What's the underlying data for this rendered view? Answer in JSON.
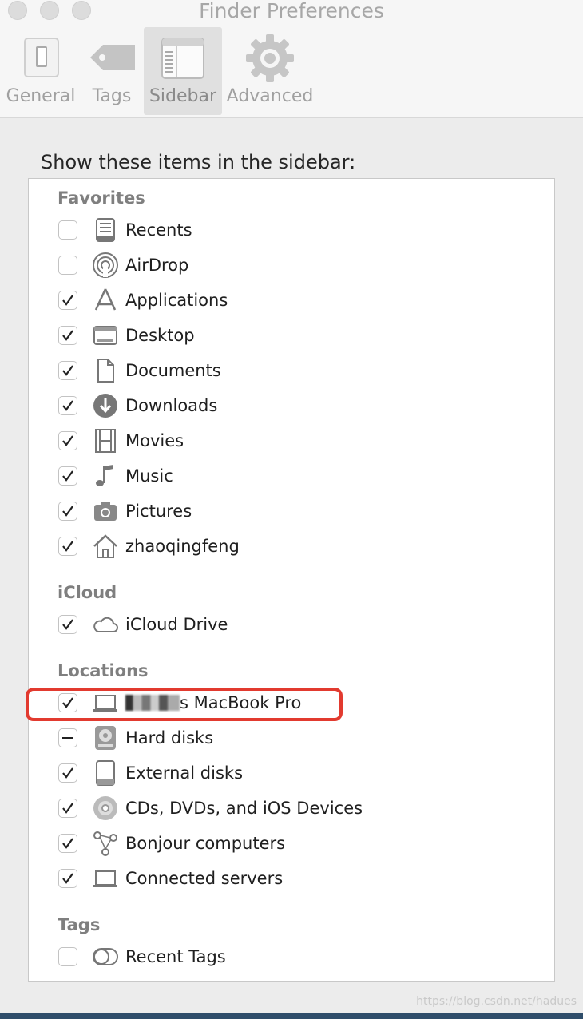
{
  "window": {
    "title": "Finder Preferences"
  },
  "toolbar": {
    "tabs": [
      {
        "label": "General",
        "icon": "general-switch-icon",
        "selected": false
      },
      {
        "label": "Tags",
        "icon": "tag-icon",
        "selected": false
      },
      {
        "label": "Sidebar",
        "icon": "sidebar-icon",
        "selected": true
      },
      {
        "label": "Advanced",
        "icon": "gear-icon",
        "selected": false
      }
    ]
  },
  "main": {
    "heading": "Show these items in the sidebar:"
  },
  "sections": {
    "favorites": {
      "title": "Favorites",
      "items": [
        {
          "label": "Recents",
          "checked": false,
          "icon": "recents-icon"
        },
        {
          "label": "AirDrop",
          "checked": false,
          "icon": "airdrop-icon"
        },
        {
          "label": "Applications",
          "checked": true,
          "icon": "applications-icon"
        },
        {
          "label": "Desktop",
          "checked": true,
          "icon": "desktop-icon"
        },
        {
          "label": "Documents",
          "checked": true,
          "icon": "documents-icon"
        },
        {
          "label": "Downloads",
          "checked": true,
          "icon": "downloads-icon"
        },
        {
          "label": "Movies",
          "checked": true,
          "icon": "movies-icon"
        },
        {
          "label": "Music",
          "checked": true,
          "icon": "music-icon"
        },
        {
          "label": "Pictures",
          "checked": true,
          "icon": "pictures-icon"
        },
        {
          "label": "zhaoqingfeng",
          "checked": true,
          "icon": "home-icon"
        }
      ]
    },
    "icloud": {
      "title": "iCloud",
      "items": [
        {
          "label": "iCloud Drive",
          "checked": true,
          "icon": "cloud-icon"
        }
      ]
    },
    "locations": {
      "title": "Locations",
      "items": [
        {
          "label": "s MacBook Pro",
          "checked": true,
          "icon": "laptop-icon"
        },
        {
          "label": "Hard disks",
          "checked": "mixed",
          "icon": "hard-disk-icon"
        },
        {
          "label": "External disks",
          "checked": true,
          "icon": "external-disk-icon"
        },
        {
          "label": "CDs, DVDs, and iOS Devices",
          "checked": true,
          "icon": "cd-icon"
        },
        {
          "label": "Bonjour computers",
          "checked": true,
          "icon": "bonjour-icon"
        },
        {
          "label": "Connected servers",
          "checked": true,
          "icon": "server-icon"
        }
      ]
    },
    "tags": {
      "title": "Tags",
      "items": [
        {
          "label": "Recent Tags",
          "checked": false,
          "icon": "tags-toggle-icon"
        }
      ]
    }
  },
  "watermark": "https://blog.csdn.net/hadues"
}
